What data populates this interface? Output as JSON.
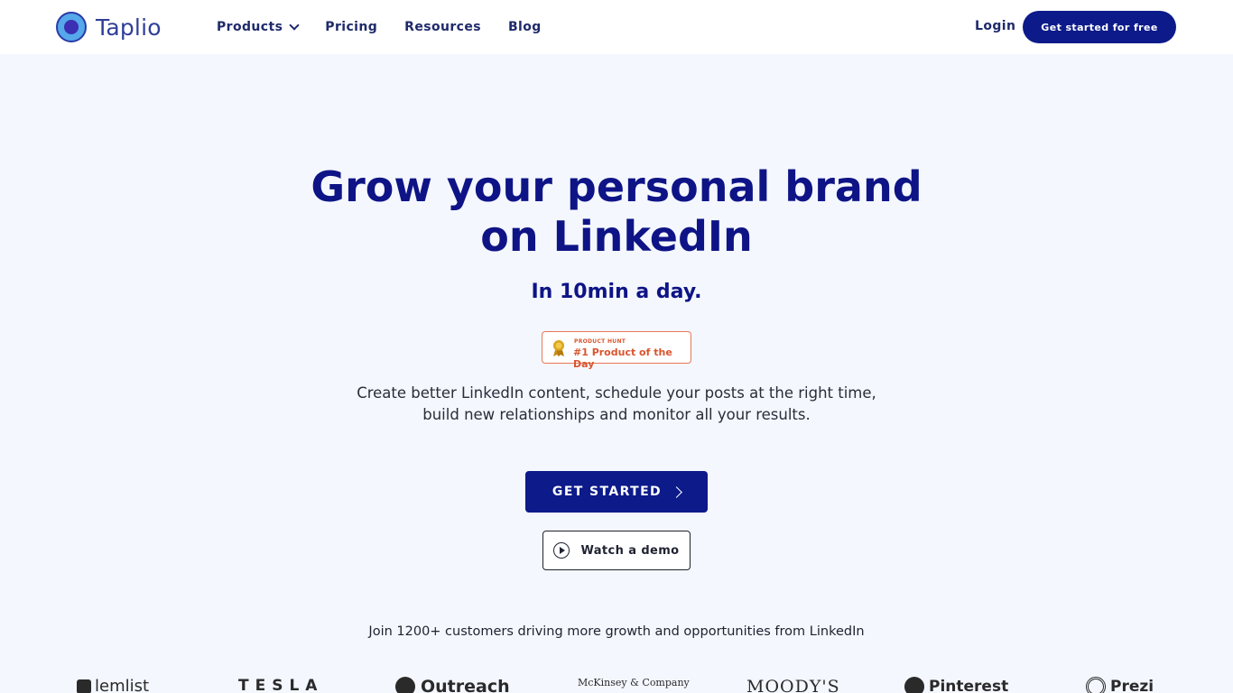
{
  "brand": {
    "name": "Taplio"
  },
  "nav": {
    "items": [
      {
        "label": "Products",
        "has_dropdown": true
      },
      {
        "label": "Pricing"
      },
      {
        "label": "Resources"
      },
      {
        "label": "Blog"
      }
    ],
    "login": "Login",
    "cta": "Get started for free"
  },
  "hero": {
    "title_line1": "Grow your personal brand",
    "title_line2": "on LinkedIn",
    "subtitle": "In 10min a day.",
    "badge": {
      "small": "PRODUCT HUNT",
      "big": "#1 Product of the Day"
    },
    "description_line1": "Create better LinkedIn content, schedule your posts at the right time,",
    "description_line2": "build new relationships and monitor all your results.",
    "primary_cta": "GET STARTED",
    "demo_cta": "Watch a demo"
  },
  "social_proof": {
    "text": "Join 1200+ customers driving more growth and opportunities from LinkedIn",
    "logos": [
      "lemlist",
      "TESLA",
      "Outreach",
      "McKinsey & Company",
      "MOODY'S",
      "Pinterest",
      "Prezi"
    ]
  },
  "colors": {
    "primary": "#0c1a8a",
    "heading": "#0e1486",
    "background": "#f4f7fd",
    "product_hunt": "#da552f"
  }
}
